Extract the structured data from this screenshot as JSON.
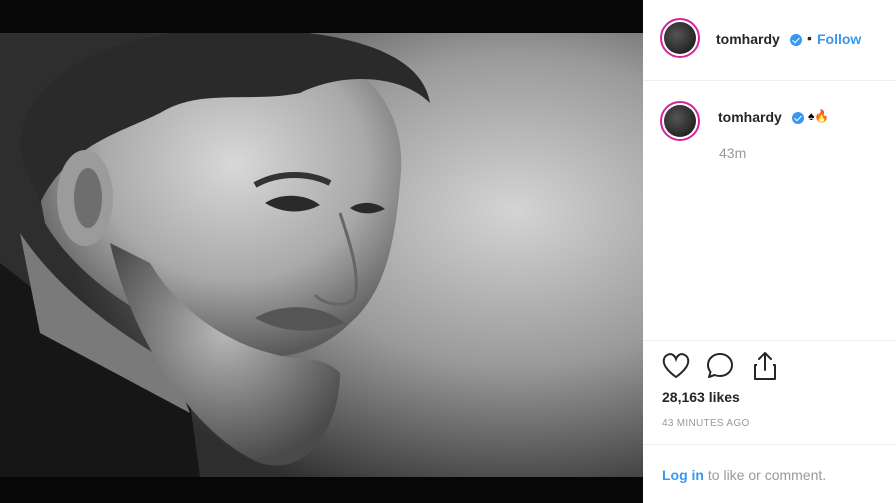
{
  "post": {
    "username": "tomhardy",
    "follow_label": "Follow",
    "separator": "•",
    "caption_emoji": "♠🔥",
    "caption_time": "43m",
    "likes": "28,163 likes",
    "posted_ago": "43 MINUTES AGO",
    "login_link": "Log in",
    "login_suffix": " to like or comment."
  },
  "icons": {
    "like": "heart-icon",
    "comment": "comment-bubble-icon",
    "share": "share-upload-icon"
  },
  "colors": {
    "accent": "#3897f0",
    "text": "#262626",
    "muted": "#999999"
  }
}
